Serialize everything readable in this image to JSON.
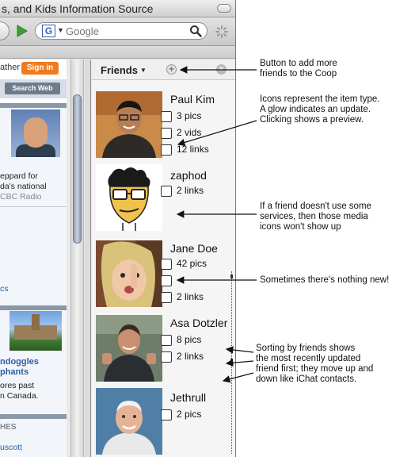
{
  "window": {
    "title": "s, and Kids Information Source"
  },
  "toolbar": {
    "search_engine": "G",
    "search_placeholder": "Google"
  },
  "webpage": {
    "weather_link": "ather",
    "signin_label": "Sign in",
    "search_web_label": "Search Web",
    "story1": {
      "lines": [
        "eppard for",
        "da's national"
      ],
      "source": "CBC Radio"
    },
    "cs_link": "cs",
    "story2": {
      "headline": [
        "ndoggles",
        "phants"
      ],
      "lines": [
        "ores past",
        "n Canada."
      ]
    },
    "section_label": "HES",
    "bottom_link": "uscott"
  },
  "sidebar": {
    "menu_label": "Friends",
    "add_icon": "plus-circle-icon",
    "close_icon": "close-circle-icon",
    "friends": [
      {
        "name": "Paul Kim",
        "items": [
          "3 pics",
          "2 vids",
          "12 links"
        ]
      },
      {
        "name": "zaphod",
        "items": [
          "2 links"
        ]
      },
      {
        "name": "Jane Doe",
        "items": [
          "42 pics",
          "",
          "2 links"
        ]
      },
      {
        "name": "Asa Dotzler",
        "items": [
          "8 pics",
          "2 links"
        ]
      },
      {
        "name": "Jethrull",
        "items": [
          "2 pics"
        ]
      }
    ]
  },
  "annotations": {
    "add_friends": [
      "Button to add more",
      "friends to the Coop"
    ],
    "icons": [
      "Icons represent the item type.",
      "A glow indicates an update.",
      "Clicking shows a preview."
    ],
    "missing_services": [
      "If a friend doesn't use some",
      "services, then those media",
      "icons won't show up"
    ],
    "nothing_new": [
      "Sometimes there's nothing new!"
    ],
    "sorting": [
      "Sorting by friends shows",
      "the most recently updated",
      "friend first; they move up and",
      "down like iChat contacts."
    ]
  },
  "colors": {
    "signin_orange": "#f07b1f",
    "link_blue": "#2d5fa8",
    "go_green": "#3aa02c"
  }
}
